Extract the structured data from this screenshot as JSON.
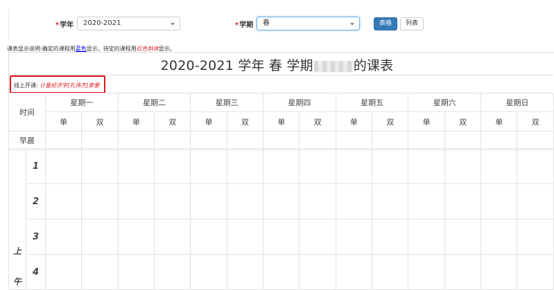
{
  "filters": {
    "year_label": "学年",
    "year_value": "2020-2021",
    "term_label": "学期",
    "term_value": "春",
    "table_button": "表格",
    "list_button": "列表"
  },
  "note": {
    "prefix": "课表显示说明:确定的课程用",
    "blue_word": "蓝色",
    "mid": "显示，待定的课程用",
    "red_word": "红色斜体",
    "suffix": "显示。"
  },
  "title": {
    "prefix": "2020-2021 学年 春 学期",
    "suffix": "的课表"
  },
  "online": {
    "label": "线上开课:",
    "course": "计量经济学[孔伟杰]索要"
  },
  "table": {
    "time_header": "时间",
    "days": [
      "星期一",
      "星期二",
      "星期三",
      "星期四",
      "星期五",
      "星期六",
      "星期日"
    ],
    "single": "单",
    "double": "双",
    "morning": "早晨",
    "am_label_1": "上",
    "am_label_2": "午",
    "periods": [
      "1",
      "2",
      "3",
      "4"
    ]
  },
  "colors": {
    "primary_button": "#337ab7",
    "highlight_box": "#e5141b",
    "required_mark": "#d9232d"
  }
}
